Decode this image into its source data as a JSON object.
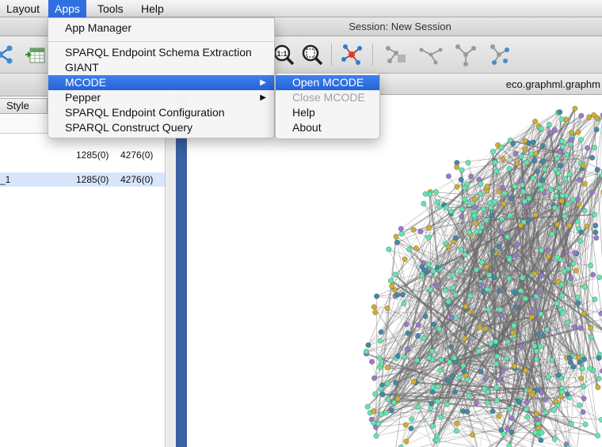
{
  "menubar": {
    "items": [
      {
        "label": "Layout"
      },
      {
        "label": "Apps"
      },
      {
        "label": "Tools"
      },
      {
        "label": "Help"
      }
    ]
  },
  "window": {
    "session_title": "Session: New Session"
  },
  "apps_menu": {
    "items": [
      {
        "label": "App Manager"
      },
      {
        "label": "SPARQL Endpoint Schema Extraction"
      },
      {
        "label": "GIANT"
      },
      {
        "label": "MCODE"
      },
      {
        "label": "Pepper"
      },
      {
        "label": "SPARQL Endpoint Configuration"
      },
      {
        "label": "SPARQL Construct Query"
      }
    ],
    "submenu_arrow": "▶"
  },
  "mcode_menu": {
    "items": [
      {
        "label": "Open MCODE",
        "enabled": true
      },
      {
        "label": "Close MCODE",
        "enabled": false
      },
      {
        "label": "Help",
        "enabled": true
      },
      {
        "label": "About",
        "enabled": true
      }
    ]
  },
  "left_panel": {
    "style_tab": "Style",
    "networks": [
      {
        "name": "",
        "nodes": "1285(0)",
        "edges": "4276(0)"
      },
      {
        "name": "_1",
        "nodes": "1285(0)",
        "edges": "4276(0)"
      }
    ]
  },
  "network_view": {
    "title": "eco.graphml.graphm"
  },
  "colors": {
    "accent": "#2f6fe0",
    "node_green": "#5de8b0",
    "node_teal": "#3f8aa6",
    "node_purple": "#9a78d0",
    "node_gold": "#d2ae2c",
    "edge": "#6a6a6a"
  }
}
